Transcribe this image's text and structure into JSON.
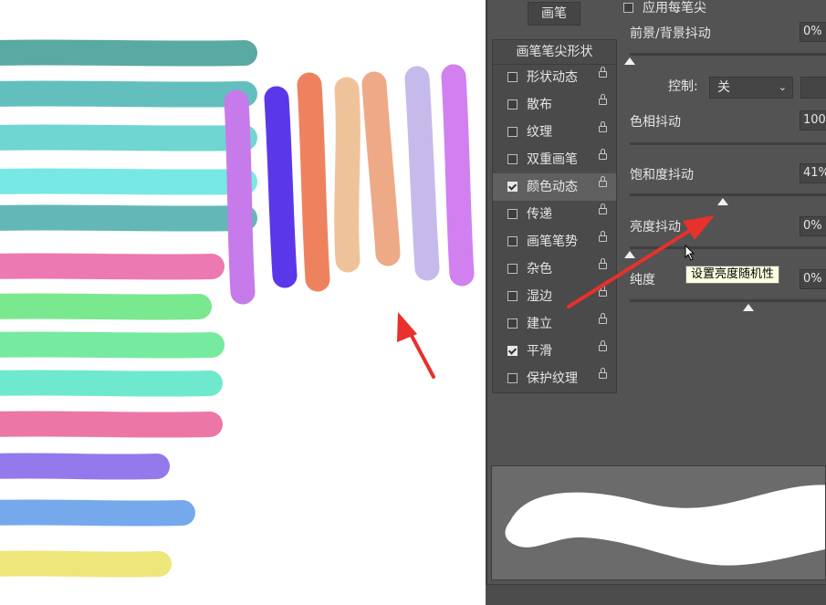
{
  "panel": {
    "brush_tab": "画笔",
    "apply_per_tip": "应用每笔尖",
    "list_header": "画笔笔尖形状",
    "items": [
      {
        "label": "形状动态",
        "checked": false,
        "selected": false
      },
      {
        "label": "散布",
        "checked": false,
        "selected": false
      },
      {
        "label": "纹理",
        "checked": false,
        "selected": false
      },
      {
        "label": "双重画笔",
        "checked": false,
        "selected": false
      },
      {
        "label": "颜色动态",
        "checked": true,
        "selected": true
      },
      {
        "label": "传递",
        "checked": false,
        "selected": false
      },
      {
        "label": "画笔笔势",
        "checked": false,
        "selected": false
      },
      {
        "label": "杂色",
        "checked": false,
        "selected": false
      },
      {
        "label": "湿边",
        "checked": false,
        "selected": false
      },
      {
        "label": "建立",
        "checked": false,
        "selected": false
      },
      {
        "label": "平滑",
        "checked": true,
        "selected": false
      },
      {
        "label": "保护纹理",
        "checked": false,
        "selected": false
      }
    ],
    "params": [
      {
        "label": "前景/背景抖动",
        "value": "0%",
        "level": 0
      },
      {
        "label": "色相抖动",
        "value": "100%",
        "level": 1
      },
      {
        "label": "饱和度抖动",
        "value": "41%",
        "level": 0.41
      },
      {
        "label": "亮度抖动",
        "value": "0%",
        "level": 0
      },
      {
        "label": "纯度",
        "value": "0%",
        "level": 0.5
      }
    ],
    "control_label": "控制:",
    "control_value": "关",
    "tooltip": "设置亮度随机性"
  },
  "canvas": {
    "horizontal_strokes": [
      "#5aa9a3",
      "#62bfbd",
      "#6fd6d1",
      "#77e8e4",
      "#63b8b7",
      "#ec79b1",
      "#79e88f",
      "#76ea9e",
      "#6fe9ce",
      "#ec76a6",
      "#9479ec",
      "#76a9ec",
      "#ede67a"
    ],
    "vertical_strokes": [
      "#c77aea",
      "#5a38ea",
      "#ee825f",
      "#efc39a",
      "#eea987",
      "#c6baeb",
      "#d27ff0"
    ]
  },
  "colors": {
    "panel_bg": "#535353",
    "accent_arrow": "#e8302c",
    "tooltip_bg": "#ffffe1"
  }
}
